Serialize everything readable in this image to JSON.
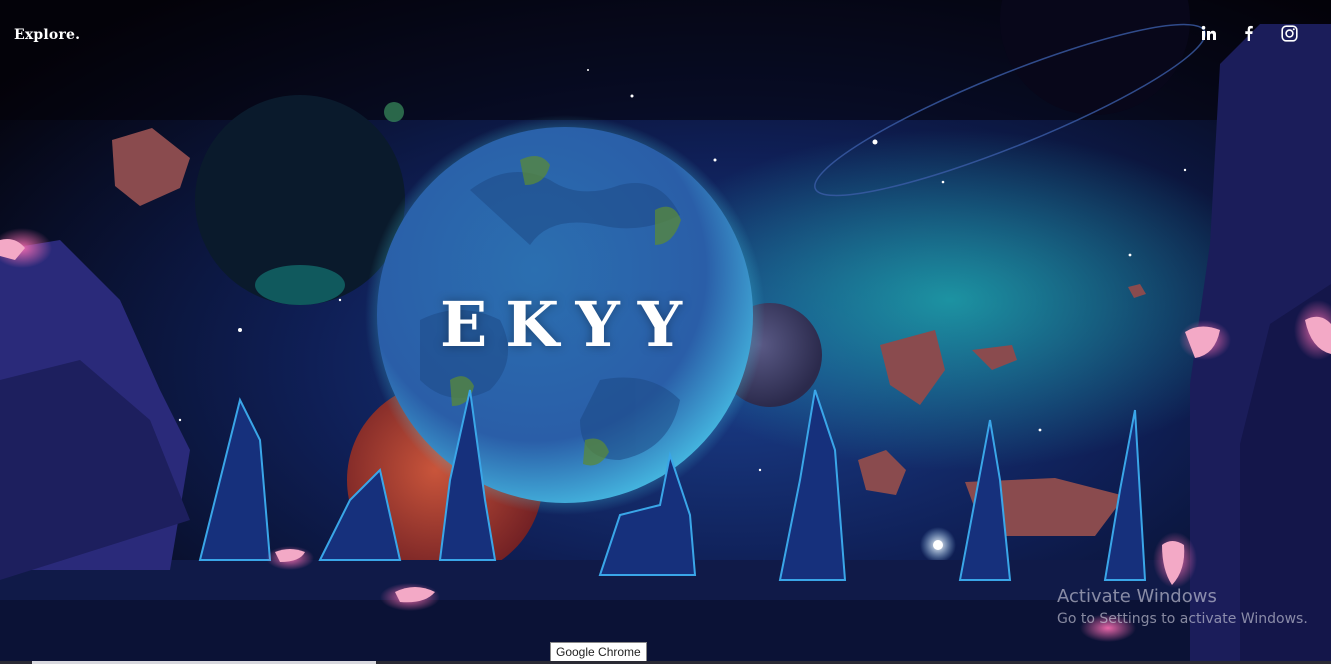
{
  "nav": {
    "brand": "Explore."
  },
  "social": [
    {
      "icon": "linkedin-icon",
      "label": "in"
    },
    {
      "icon": "facebook-icon",
      "label": "f"
    },
    {
      "icon": "instagram-icon",
      "label": ""
    }
  ],
  "hero": {
    "title": "EKYY"
  },
  "watermark": {
    "title": "Activate Windows",
    "subtitle": "Go to Settings to activate Windows."
  },
  "tooltip": {
    "text": "Google Chrome"
  },
  "colors": {
    "background": "#05040c",
    "planet": "#2f86c8",
    "text": "#ffffff",
    "accent": "#2ec0d8"
  }
}
